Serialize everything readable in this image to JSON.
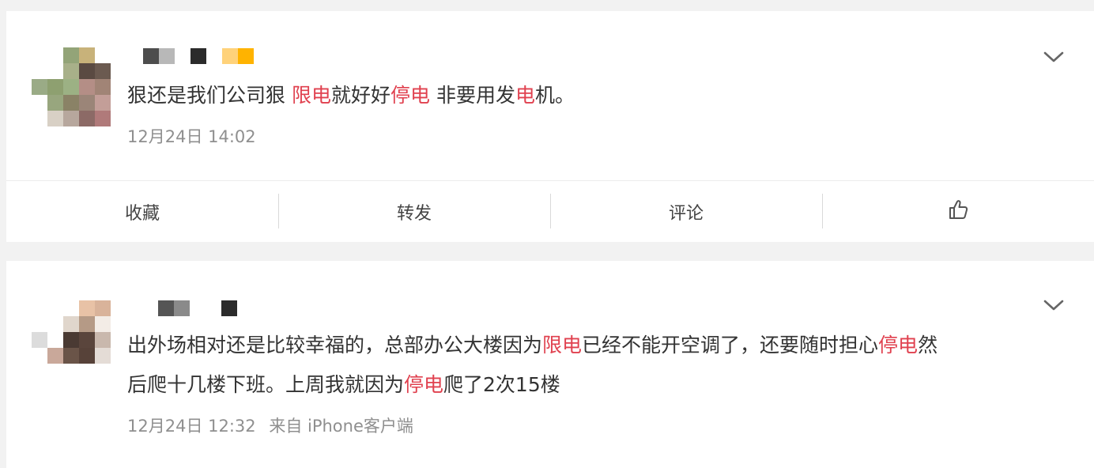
{
  "posts": [
    {
      "text_segments": [
        {
          "text": "狠还是我们公司狠 ",
          "highlight": false
        },
        {
          "text": "限电",
          "highlight": true
        },
        {
          "text": "就好好",
          "highlight": false
        },
        {
          "text": "停电",
          "highlight": true
        },
        {
          "text": " 非要用发",
          "highlight": false
        },
        {
          "text": "电",
          "highlight": true
        },
        {
          "text": "机。",
          "highlight": false
        }
      ],
      "timestamp": "12月24日 14:02",
      "source": ""
    },
    {
      "line1_segments": [
        {
          "text": "出外场相对还是比较幸福的，总部办公大楼因为",
          "highlight": false
        },
        {
          "text": "限电",
          "highlight": true
        },
        {
          "text": "已经不能开空调了，还要随时担心",
          "highlight": false
        },
        {
          "text": "停电",
          "highlight": true
        },
        {
          "text": "然",
          "highlight": false
        }
      ],
      "line2_segments": [
        {
          "text": "后爬十几楼下班。上周我就因为",
          "highlight": false
        },
        {
          "text": "停电",
          "highlight": true
        },
        {
          "text": "爬了2次15楼",
          "highlight": false
        }
      ],
      "timestamp": "12月24日 12:32",
      "source": "来自 iPhone客户端"
    }
  ],
  "actions": {
    "favorite_label": "收藏",
    "repost_label": "转发",
    "comment_label": "评论",
    "like_icon": "thumbs-up-icon"
  },
  "icons": {
    "expand": "chevron-down-icon"
  },
  "colors": {
    "highlight": "#e0414f",
    "meta_text": "#8f8f8f",
    "body_text": "#333333"
  }
}
